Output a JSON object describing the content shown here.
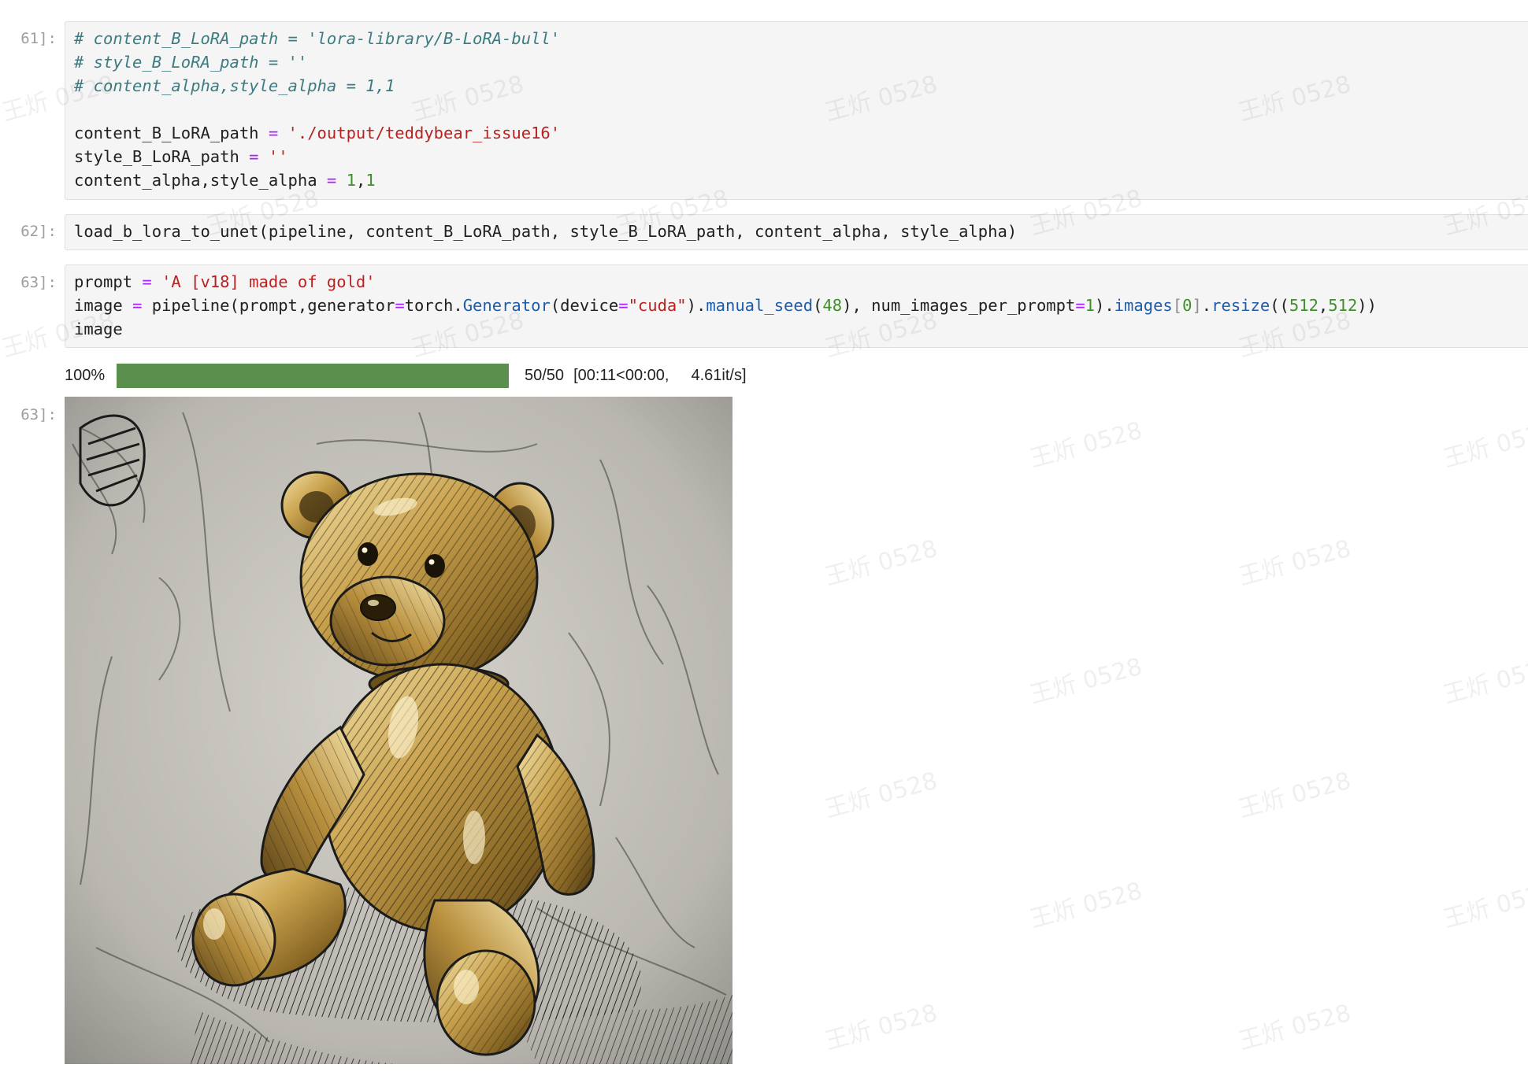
{
  "cells": [
    {
      "prompt": "61]:",
      "lines": [
        "# content_B_LoRA_path = 'lora-library/B-LoRA-bull'",
        "# style_B_LoRA_path = ''",
        "# content_alpha,style_alpha = 1,1",
        "",
        "content_B_LoRA_path = './output/teddybear_issue16'",
        "style_B_LoRA_path = ''",
        "content_alpha,style_alpha = 1,1"
      ]
    },
    {
      "prompt": "62]:",
      "lines": [
        "load_b_lora_to_unet(pipeline, content_B_LoRA_path, style_B_LoRA_path, content_alpha, style_alpha)"
      ]
    },
    {
      "prompt": "63]:",
      "lines": [
        "prompt = 'A [v18] made of gold'",
        "image = pipeline(prompt,generator=torch.Generator(device=\"cuda\").manual_seed(48), num_images_per_prompt=1).images[0].resize((512,512))",
        "image"
      ]
    }
  ],
  "output": {
    "prompt": "63]:",
    "progress": {
      "percent_label": "100%",
      "fraction": 1.0,
      "count": "50/50",
      "time": "[00:11<00:00,",
      "rate": "4.61it/s]",
      "bar_color": "#5b8f4e"
    },
    "image_subject": "gold-teddy-bear-sketch"
  },
  "watermark": "王炘 0528"
}
